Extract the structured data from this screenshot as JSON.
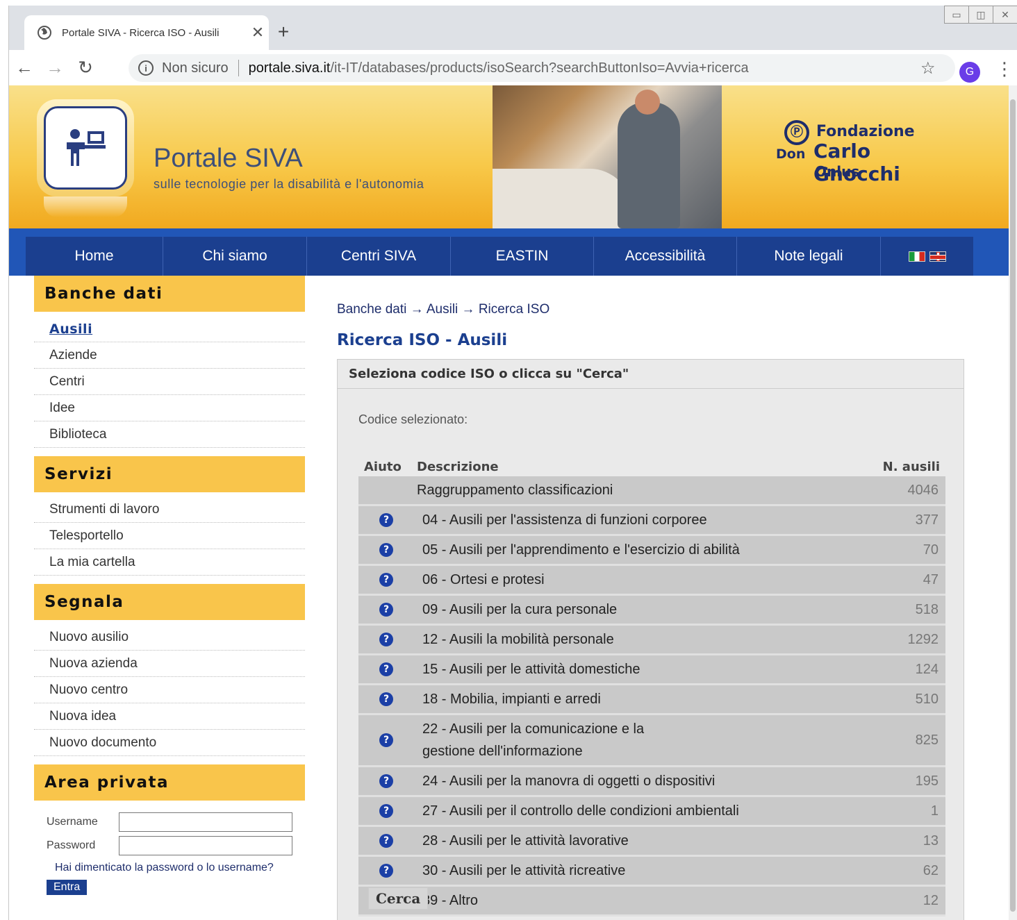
{
  "browser": {
    "tab_title": "Portale SIVA - Ricerca ISO - Ausili",
    "tab_close": "✕",
    "new_tab": "+",
    "address_insecure": "Non sicuro",
    "address_host": "portale.siva.it",
    "address_path": "/it-IT/databases/products/isoSearch?searchButtonIso=Avvia+ricerca",
    "profile_initial": "G"
  },
  "header": {
    "site_title": "Portale SIVA",
    "site_subtitle": "sulle tecnologie per la disabilità e l'autonomia",
    "foundation_line1": "Fondazione",
    "foundation_line2a": "Don",
    "foundation_line2b": "Carlo Gnocchi",
    "foundation_line3": "Onlus"
  },
  "nav": {
    "items": [
      {
        "label": "Home"
      },
      {
        "label": "Chi siamo"
      },
      {
        "label": "Centri SIVA"
      },
      {
        "label": "EASTIN"
      },
      {
        "label": "Accessibilità"
      },
      {
        "label": "Note legali"
      }
    ]
  },
  "sidebar": {
    "banche_dati": {
      "title": "Banche dati",
      "items": [
        "Ausili",
        "Aziende",
        "Centri",
        "Idee",
        "Biblioteca"
      ]
    },
    "servizi": {
      "title": "Servizi",
      "items": [
        "Strumenti di lavoro",
        "Telesportello",
        "La mia cartella"
      ]
    },
    "segnala": {
      "title": "Segnala",
      "items": [
        "Nuovo ausilio",
        "Nuova azienda",
        "Nuovo centro",
        "Nuova idea",
        "Nuovo documento"
      ]
    },
    "area_privata": {
      "title": "Area privata",
      "username_label": "Username",
      "password_label": "Password",
      "forgot_link": "Hai dimenticato la password o lo username?",
      "login_button": "Entra"
    }
  },
  "main": {
    "breadcrumb": "Banche dati → Ausili → Ricerca ISO",
    "title": "Ricerca ISO - Ausili",
    "panel_header": "Seleziona codice ISO o clicca su \"Cerca\"",
    "selected_code_label": "Codice selezionato:",
    "columns": {
      "help": "Aiuto",
      "description": "Descrizione",
      "count": "N. ausili"
    },
    "group_row": {
      "description": "Raggruppamento classificazioni",
      "count": "4046"
    },
    "rows": [
      {
        "description": "04 - Ausili per l'assistenza di funzioni corporee",
        "count": "377"
      },
      {
        "description": "05 - Ausili per l'apprendimento e l'esercizio di abilità",
        "count": "70"
      },
      {
        "description": "06 - Ortesi e protesi",
        "count": "47"
      },
      {
        "description": "09 - Ausili per la cura personale",
        "count": "518"
      },
      {
        "description": "12 - Ausili la mobilità personale",
        "count": "1292"
      },
      {
        "description": "15 - Ausili per le attività domestiche",
        "count": "124"
      },
      {
        "description": "18 - Mobilia, impianti e arredi",
        "count": "510"
      },
      {
        "description": "22 - Ausili per la comunicazione e la gestione dell'informazione",
        "count": "825"
      },
      {
        "description": "24 - Ausili per la manovra di oggetti o dispositivi",
        "count": "195"
      },
      {
        "description": "27 - Ausili per il controllo delle condizioni ambientali",
        "count": "1"
      },
      {
        "description": "28 - Ausili per le attività lavorative",
        "count": "13"
      },
      {
        "description": "30 - Ausili per le attività ricreative",
        "count": "62"
      },
      {
        "description": "89 - Altro",
        "count": "12"
      }
    ],
    "help_glyph": "?",
    "search_button": "Cerca"
  }
}
